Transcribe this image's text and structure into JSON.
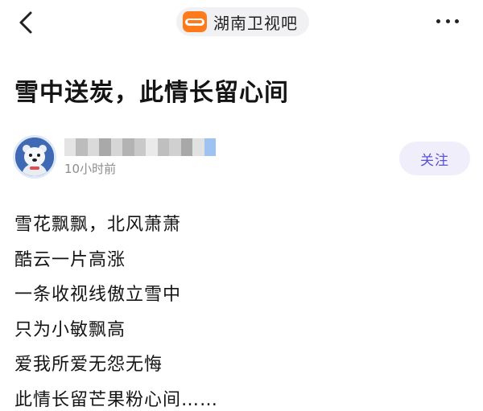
{
  "header": {
    "forum_name": "湖南卫视吧",
    "back_icon": "chevron-left-icon",
    "more_icon": "more-dots-icon",
    "forum_logo_color": "#ff7a1a"
  },
  "post": {
    "title": "雪中送炭，此情长留心间",
    "author": {
      "time": "10小时前",
      "follow_label": "关注",
      "follow_color": "#5b50d6"
    },
    "lines": [
      "雪花飘飘，北风萧萧",
      "酷云一片高涨",
      "一条收视线傲立雪中",
      "只为小敏飘高",
      "爱我所爱无怨无悔",
      "此情长留芒果粉心间……"
    ]
  }
}
